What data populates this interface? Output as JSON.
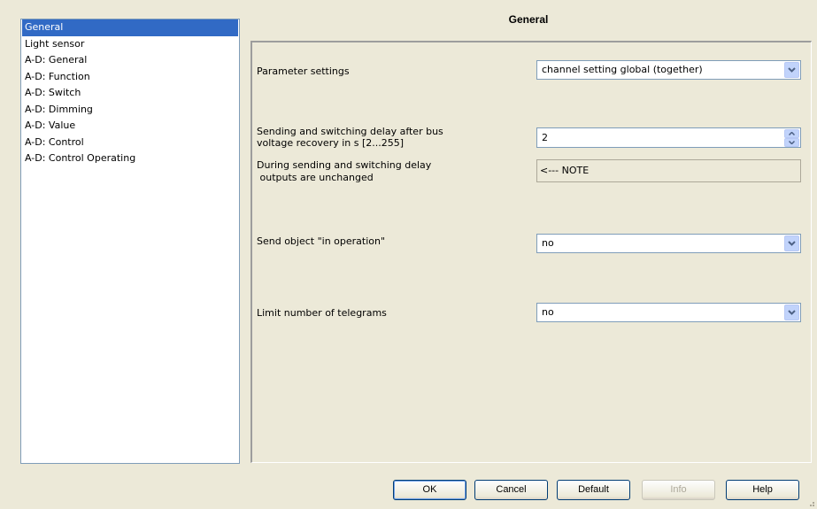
{
  "sidebar": {
    "items": [
      {
        "label": "General"
      },
      {
        "label": "Light sensor"
      },
      {
        "label": "A-D: General"
      },
      {
        "label": "A-D: Function"
      },
      {
        "label": "A-D: Switch"
      },
      {
        "label": "A-D: Dimming"
      },
      {
        "label": "A-D: Value"
      },
      {
        "label": "A-D: Control"
      },
      {
        "label": "A-D: Control Operating"
      }
    ],
    "selected": "General"
  },
  "header": {
    "title": "General"
  },
  "params": {
    "parameter_settings": {
      "label": "Parameter settings",
      "value": "channel setting global (together)"
    },
    "delay": {
      "label_line1": "Sending and switching delay after bus",
      "label_line2": "voltage recovery in s [2...255]",
      "value": "2"
    },
    "note": {
      "label_line1": "During sending and switching delay",
      "label_line2": " outputs are unchanged",
      "value": "<--- NOTE"
    },
    "send_object": {
      "label": "Send object \"in operation\"",
      "value": "no"
    },
    "limit_telegrams": {
      "label": "Limit number of telegrams",
      "value": "no"
    }
  },
  "buttons": {
    "ok": "OK",
    "cancel": "Cancel",
    "default": "Default",
    "info": "Info",
    "help": "Help"
  },
  "colors": {
    "selection": "#316ac5",
    "window_bg": "#ece9d8",
    "field_border": "#7f9db9"
  }
}
